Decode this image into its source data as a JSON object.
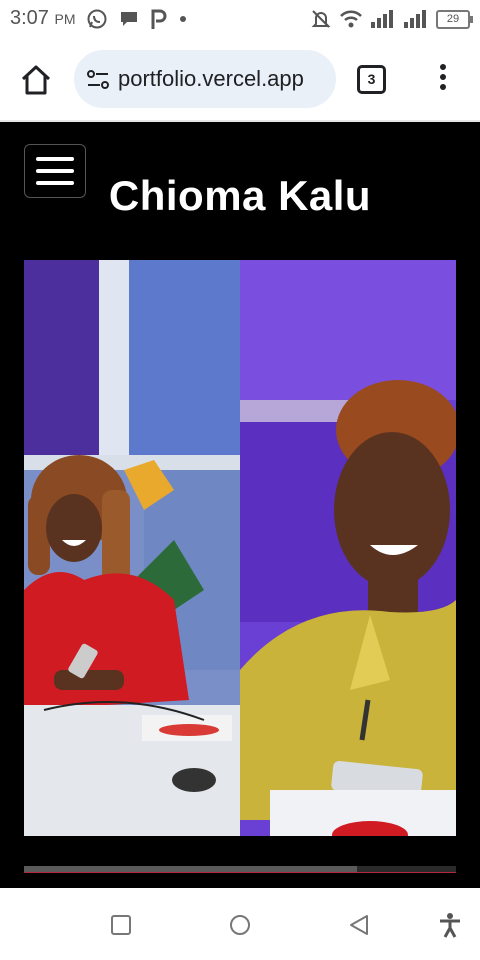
{
  "status_bar": {
    "time": "3:07",
    "ampm": "PM",
    "battery": "29",
    "notification_icons": [
      "whatsapp-icon",
      "chat-bubble-icon",
      "p-icon",
      "dot-icon"
    ],
    "system_icons": [
      "mute-icon",
      "wifi-icon",
      "signal-icon",
      "signal-icon",
      "battery-icon"
    ]
  },
  "browser": {
    "url": "portfolio.vercel.app",
    "tab_count": "3"
  },
  "page": {
    "title": "Chioma Kalu",
    "slider_progress": 0.77,
    "accent_color": "#b02a3a"
  },
  "nav_bar": {
    "buttons": [
      "recents-square-icon",
      "home-circle-icon",
      "back-triangle-icon",
      "accessibility-icon"
    ]
  }
}
